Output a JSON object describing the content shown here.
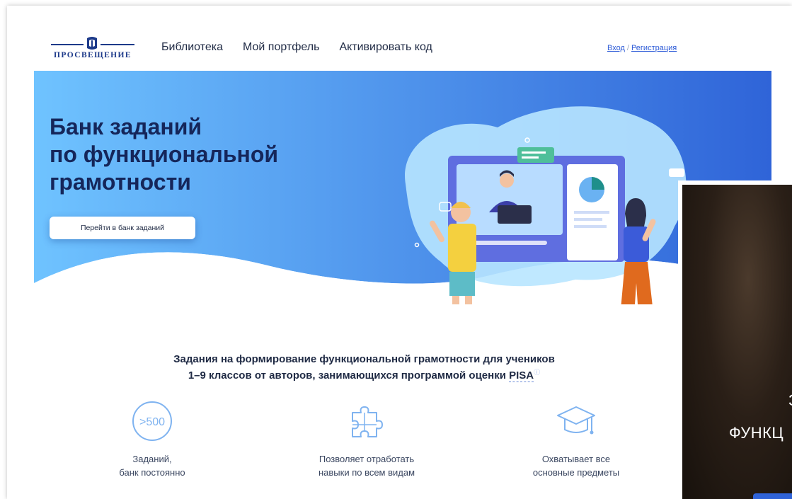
{
  "header": {
    "logo_text": "ПРОСВЕЩЕНИЕ",
    "nav": [
      "Библиотека",
      "Мой портфель",
      "Активировать код"
    ],
    "login": "Вход",
    "separator": "/",
    "register": "Регистрация"
  },
  "hero": {
    "title": "Банк заданий\nпо функциональной\nграмотности",
    "button": "Перейти в банк заданий"
  },
  "info": {
    "tagline_line1": "Задания на формирование функциональной грамотности для учеников",
    "tagline_line2": "1–9 классов от авторов, занимающихся программой оценки",
    "tagline_pisa": "PISA",
    "features": [
      {
        "icon": "counter-500-icon",
        "badge": ">500",
        "text": "Заданий,\nбанк постоянно"
      },
      {
        "icon": "puzzle-icon",
        "text": "Позволяет отработать\nнавыки по всем видам"
      },
      {
        "icon": "graduation-cap-icon",
        "text": "Охватывает все\nосновные предметы"
      }
    ]
  },
  "video": {
    "line1": "З",
    "line2": "ФУНКЦ"
  },
  "colors": {
    "brand": "#1d3a8a",
    "hero_gradient_start": "#6fc3ff",
    "hero_gradient_end": "#2f64d8",
    "accent": "#2d5bd7",
    "icon_blue": "#7fb3f0"
  }
}
